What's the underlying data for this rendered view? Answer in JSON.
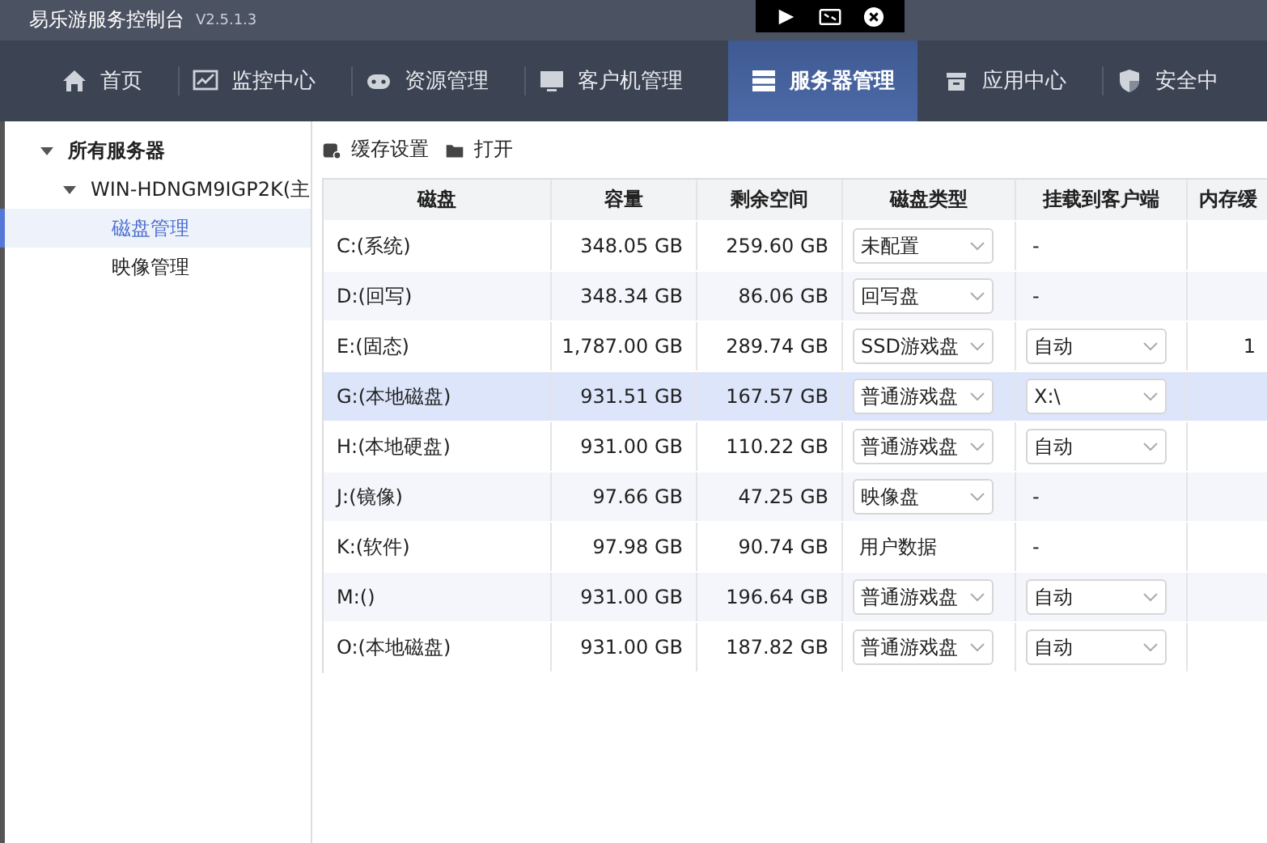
{
  "window": {
    "title": "易乐游服务控制台",
    "version": "V2.5.1.3"
  },
  "nav": [
    {
      "label": "首页",
      "selected": false
    },
    {
      "label": "监控中心",
      "selected": false
    },
    {
      "label": "资源管理",
      "selected": false
    },
    {
      "label": "客户机管理",
      "selected": false
    },
    {
      "label": "服务器管理",
      "selected": true
    },
    {
      "label": "应用中心",
      "selected": false
    },
    {
      "label": "安全中",
      "selected": false
    }
  ],
  "sidebar": {
    "items": [
      {
        "label": "所有服务器",
        "expanded": true,
        "children": [
          {
            "label": "WIN-HDNGM9IGP2K(主",
            "expanded": true,
            "children": [
              {
                "label": "磁盘管理",
                "selected": true
              },
              {
                "label": "映像管理",
                "selected": false
              }
            ]
          }
        ]
      }
    ]
  },
  "toolbar": [
    {
      "label": "缓存设置"
    },
    {
      "label": "打开"
    }
  ],
  "table": {
    "columns": [
      "磁盘",
      "容量",
      "剩余空间",
      "磁盘类型",
      "挂载到客户端",
      "内存缓"
    ],
    "rows": [
      {
        "selected": false,
        "disk": "C:(系统)",
        "capacity": "348.05 GB",
        "free": "259.60 GB",
        "type": {
          "kind": "select",
          "value": "未配置"
        },
        "mount": {
          "kind": "text",
          "value": "-"
        },
        "cache": ""
      },
      {
        "selected": false,
        "disk": "D:(回写)",
        "capacity": "348.34 GB",
        "free": "86.06 GB",
        "type": {
          "kind": "select",
          "value": "回写盘"
        },
        "mount": {
          "kind": "text",
          "value": "-"
        },
        "cache": ""
      },
      {
        "selected": false,
        "disk": "E:(固态)",
        "capacity": "1,787.00 GB",
        "free": "289.74 GB",
        "type": {
          "kind": "select",
          "value": "SSD游戏盘"
        },
        "mount": {
          "kind": "select",
          "value": "自动"
        },
        "cache": "1"
      },
      {
        "selected": true,
        "disk": "G:(本地磁盘)",
        "capacity": "931.51 GB",
        "free": "167.57 GB",
        "type": {
          "kind": "select",
          "value": "普通游戏盘"
        },
        "mount": {
          "kind": "select",
          "value": "X:\\"
        },
        "cache": ""
      },
      {
        "selected": false,
        "disk": "H:(本地硬盘)",
        "capacity": "931.00 GB",
        "free": "110.22 GB",
        "type": {
          "kind": "select",
          "value": "普通游戏盘"
        },
        "mount": {
          "kind": "select",
          "value": "自动"
        },
        "cache": ""
      },
      {
        "selected": false,
        "disk": "J:(镜像)",
        "capacity": "97.66 GB",
        "free": "47.25 GB",
        "type": {
          "kind": "select",
          "value": "映像盘"
        },
        "mount": {
          "kind": "text",
          "value": "-"
        },
        "cache": ""
      },
      {
        "selected": false,
        "disk": "K:(软件)",
        "capacity": "97.98 GB",
        "free": "90.74 GB",
        "type": {
          "kind": "text",
          "value": "用户数据"
        },
        "mount": {
          "kind": "text",
          "value": "-"
        },
        "cache": ""
      },
      {
        "selected": false,
        "disk": "M:()",
        "capacity": "931.00 GB",
        "free": "196.64 GB",
        "type": {
          "kind": "select",
          "value": "普通游戏盘"
        },
        "mount": {
          "kind": "select",
          "value": "自动"
        },
        "cache": ""
      },
      {
        "selected": false,
        "disk": "O:(本地磁盘)",
        "capacity": "931.00 GB",
        "free": "187.82 GB",
        "type": {
          "kind": "select",
          "value": "普通游戏盘"
        },
        "mount": {
          "kind": "select",
          "value": "自动"
        },
        "cache": ""
      }
    ]
  }
}
